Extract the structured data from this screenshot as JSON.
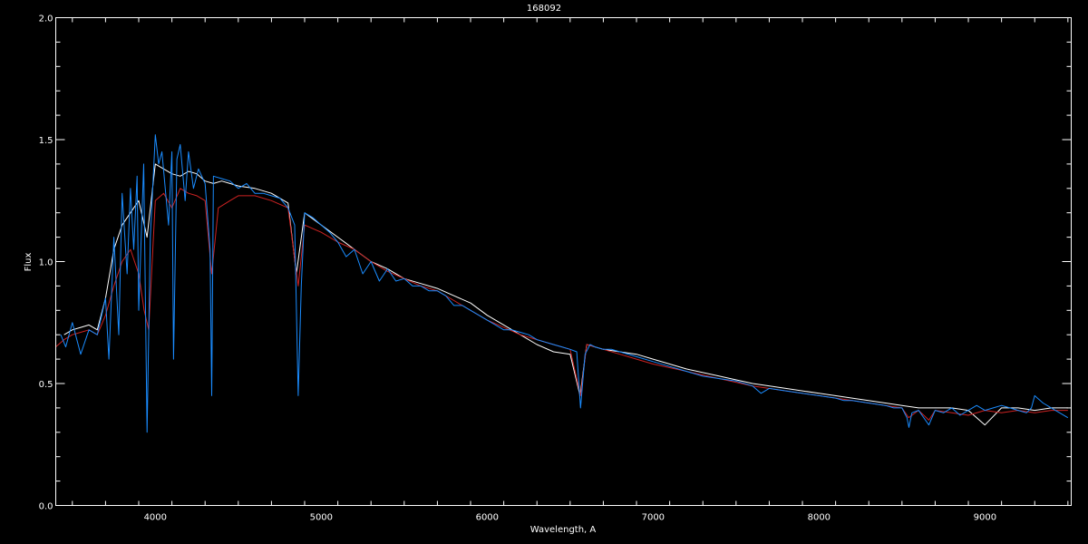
{
  "chart_data": {
    "type": "line",
    "title": "168092",
    "xlabel": "Wavelength, A",
    "ylabel": "Flux",
    "xlim": [
      3400,
      9520
    ],
    "ylim": [
      0.0,
      2.0
    ],
    "x_ticks": [
      4000,
      5000,
      6000,
      7000,
      8000,
      9000
    ],
    "x_tick_labels": [
      "4000",
      "5000",
      "6000",
      "7000",
      "8000",
      "9000"
    ],
    "y_ticks": [
      0.0,
      0.5,
      1.0,
      1.5,
      2.0
    ],
    "y_tick_labels": [
      "0.0",
      "0.5",
      "1.0",
      "1.5",
      "2.0"
    ],
    "grid": false,
    "background": "#000000",
    "axis_color": "#ffffff",
    "series": [
      {
        "color": "#ffffff",
        "x": [
          3450,
          3500,
          3550,
          3600,
          3650,
          3700,
          3750,
          3800,
          3850,
          3900,
          3950,
          4000,
          4050,
          4100,
          4150,
          4200,
          4250,
          4300,
          4350,
          4400,
          4450,
          4500,
          4600,
          4700,
          4800,
          4850,
          4900,
          5000,
          5100,
          5200,
          5300,
          5400,
          5500,
          5600,
          5700,
          5800,
          5900,
          6000,
          6100,
          6200,
          6300,
          6400,
          6500,
          6560,
          6600,
          6700,
          6800,
          6900,
          7000,
          7200,
          7400,
          7600,
          7800,
          8000,
          8200,
          8400,
          8500,
          8600,
          8700,
          8800,
          8900,
          9000,
          9100,
          9200,
          9300,
          9400,
          9500
        ],
        "y": [
          0.7,
          0.72,
          0.73,
          0.74,
          0.72,
          0.85,
          1.05,
          1.15,
          1.2,
          1.25,
          1.1,
          1.4,
          1.38,
          1.36,
          1.35,
          1.37,
          1.36,
          1.33,
          1.32,
          1.33,
          1.32,
          1.31,
          1.3,
          1.28,
          1.24,
          0.95,
          1.2,
          1.15,
          1.1,
          1.05,
          1.0,
          0.97,
          0.93,
          0.91,
          0.89,
          0.86,
          0.83,
          0.78,
          0.74,
          0.7,
          0.66,
          0.63,
          0.62,
          0.45,
          0.66,
          0.64,
          0.63,
          0.62,
          0.6,
          0.56,
          0.53,
          0.5,
          0.48,
          0.46,
          0.44,
          0.42,
          0.41,
          0.4,
          0.4,
          0.4,
          0.39,
          0.33,
          0.4,
          0.4,
          0.39,
          0.4,
          0.4
        ]
      },
      {
        "color": "#cc2222",
        "x": [
          3400,
          3450,
          3500,
          3550,
          3600,
          3650,
          3700,
          3750,
          3800,
          3850,
          3900,
          3933,
          3960,
          3970,
          4000,
          4050,
          4100,
          4150,
          4200,
          4250,
          4300,
          4340,
          4380,
          4450,
          4500,
          4600,
          4700,
          4800,
          4861,
          4900,
          5000,
          5100,
          5200,
          5300,
          5400,
          5500,
          5600,
          5700,
          5800,
          5900,
          6000,
          6100,
          6200,
          6300,
          6400,
          6500,
          6563,
          6600,
          6700,
          6800,
          6900,
          7000,
          7200,
          7400,
          7600,
          7800,
          8000,
          8200,
          8400,
          8500,
          8540,
          8600,
          8662,
          8700,
          8800,
          8900,
          9000,
          9100,
          9200,
          9300,
          9400,
          9500
        ],
        "y": [
          0.65,
          0.68,
          0.7,
          0.71,
          0.72,
          0.7,
          0.78,
          0.9,
          1.0,
          1.05,
          0.95,
          0.8,
          0.72,
          0.85,
          1.25,
          1.28,
          1.22,
          1.3,
          1.28,
          1.27,
          1.25,
          0.95,
          1.22,
          1.25,
          1.27,
          1.27,
          1.25,
          1.22,
          0.9,
          1.15,
          1.12,
          1.08,
          1.05,
          1.0,
          0.96,
          0.93,
          0.9,
          0.88,
          0.84,
          0.8,
          0.76,
          0.73,
          0.7,
          0.68,
          0.66,
          0.64,
          0.45,
          0.66,
          0.64,
          0.62,
          0.6,
          0.58,
          0.55,
          0.52,
          0.49,
          0.47,
          0.45,
          0.43,
          0.41,
          0.4,
          0.36,
          0.39,
          0.35,
          0.39,
          0.38,
          0.37,
          0.39,
          0.38,
          0.39,
          0.38,
          0.39,
          0.39
        ]
      },
      {
        "color": "#1a8cff",
        "x": [
          3430,
          3460,
          3500,
          3550,
          3600,
          3650,
          3700,
          3720,
          3750,
          3780,
          3800,
          3830,
          3850,
          3870,
          3890,
          3900,
          3930,
          3950,
          3970,
          4000,
          4020,
          4040,
          4080,
          4100,
          4110,
          4130,
          4150,
          4180,
          4200,
          4230,
          4260,
          4300,
          4330,
          4340,
          4350,
          4400,
          4450,
          4500,
          4550,
          4600,
          4650,
          4700,
          4750,
          4800,
          4840,
          4861,
          4880,
          4900,
          4950,
          5000,
          5050,
          5100,
          5150,
          5200,
          5250,
          5300,
          5350,
          5400,
          5450,
          5500,
          5550,
          5600,
          5650,
          5700,
          5750,
          5800,
          5850,
          5900,
          5950,
          6000,
          6050,
          6100,
          6150,
          6200,
          6250,
          6300,
          6350,
          6400,
          6450,
          6500,
          6540,
          6563,
          6590,
          6620,
          6650,
          6700,
          6750,
          6800,
          6900,
          7000,
          7100,
          7200,
          7300,
          7400,
          7500,
          7600,
          7650,
          7700,
          7800,
          7900,
          8000,
          8100,
          8150,
          8200,
          8300,
          8400,
          8450,
          8500,
          8530,
          8542,
          8560,
          8600,
          8662,
          8700,
          8750,
          8800,
          8850,
          8900,
          8950,
          9000,
          9050,
          9100,
          9150,
          9200,
          9250,
          9280,
          9300,
          9350,
          9400,
          9450,
          9500
        ],
        "y": [
          0.7,
          0.65,
          0.75,
          0.62,
          0.72,
          0.7,
          0.85,
          0.6,
          1.1,
          0.7,
          1.28,
          0.95,
          1.3,
          1.05,
          1.35,
          0.8,
          1.4,
          0.3,
          1.1,
          1.52,
          1.4,
          1.45,
          1.15,
          1.45,
          0.6,
          1.42,
          1.48,
          1.25,
          1.45,
          1.3,
          1.38,
          1.32,
          1.05,
          0.45,
          1.35,
          1.34,
          1.33,
          1.3,
          1.32,
          1.28,
          1.28,
          1.27,
          1.26,
          1.22,
          1.15,
          0.45,
          0.9,
          1.2,
          1.18,
          1.15,
          1.12,
          1.08,
          1.02,
          1.05,
          0.95,
          1.0,
          0.92,
          0.97,
          0.92,
          0.93,
          0.9,
          0.9,
          0.88,
          0.88,
          0.86,
          0.82,
          0.82,
          0.8,
          0.78,
          0.76,
          0.74,
          0.72,
          0.72,
          0.71,
          0.7,
          0.68,
          0.67,
          0.66,
          0.65,
          0.64,
          0.63,
          0.4,
          0.62,
          0.66,
          0.65,
          0.64,
          0.64,
          0.63,
          0.61,
          0.59,
          0.57,
          0.55,
          0.53,
          0.52,
          0.51,
          0.49,
          0.46,
          0.48,
          0.47,
          0.46,
          0.45,
          0.44,
          0.43,
          0.43,
          0.42,
          0.41,
          0.4,
          0.4,
          0.36,
          0.32,
          0.38,
          0.39,
          0.33,
          0.39,
          0.38,
          0.4,
          0.37,
          0.39,
          0.41,
          0.39,
          0.4,
          0.41,
          0.4,
          0.39,
          0.38,
          0.4,
          0.45,
          0.42,
          0.4,
          0.38,
          0.36
        ]
      }
    ]
  }
}
